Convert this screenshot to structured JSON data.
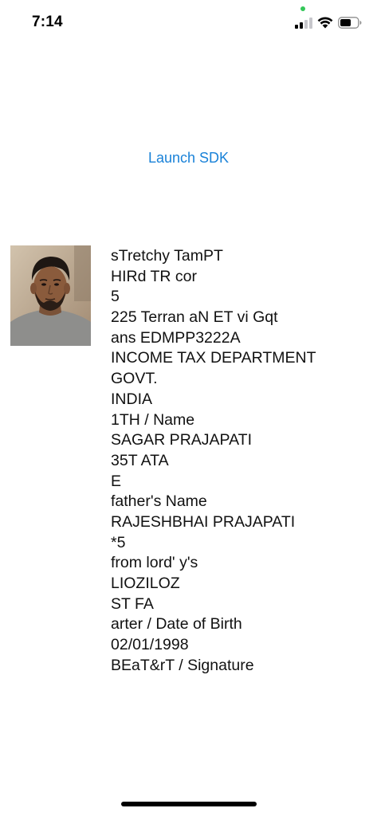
{
  "status_bar": {
    "time": "7:14",
    "privacy_dot_color": "#34c759",
    "icons": [
      "cellular-signal-icon",
      "wifi-icon",
      "battery-icon"
    ]
  },
  "launch_button": {
    "label": "Launch SDK",
    "color": "#1a82d8"
  },
  "photo": {
    "icon": "face-photo"
  },
  "ocr_lines": [
    "sTretchy TamPT",
    "HIRd TR cor",
    "5",
    "225 Terran aN ET vi Gqt",
    "ans EDMPP3222A",
    "INCOME TAX DEPARTMENT",
    "GOVT.",
    "INDIA",
    "1TH / Name",
    "SAGAR PRAJAPATI",
    "35T ATA",
    "E",
    "father's Name",
    "RAJESHBHAI PRAJAPATI",
    "*5",
    "from lord' y's",
    "LIOZILOZ",
    "ST FA",
    "arter / Date of Birth",
    "02/01/1998",
    "BEaT&rT / Signature"
  ]
}
